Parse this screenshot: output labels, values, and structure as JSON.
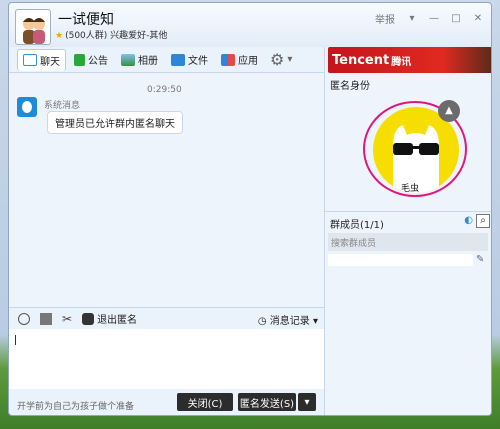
{
  "window": {
    "title": "一试便知",
    "subtitle": "(500人群) 兴趣爱好-其他",
    "controls": {
      "report": "举报",
      "dropdown": "▾",
      "minimize": "—",
      "maximize": "□",
      "close": "✕"
    }
  },
  "toolbar": {
    "items": [
      {
        "label": "聊天",
        "icon": "chat-icon",
        "active": true
      },
      {
        "label": "公告",
        "icon": "flag-icon"
      },
      {
        "label": "相册",
        "icon": "photo-icon"
      },
      {
        "label": "文件",
        "icon": "folder-icon"
      },
      {
        "label": "应用",
        "icon": "apps-icon"
      }
    ],
    "settings_icon": "gear-icon"
  },
  "banner": {
    "brand": "Tencent",
    "brand_cn": "腾讯"
  },
  "anonymous": {
    "section_label": "匿名身份",
    "name": "毛虫",
    "badge_icon": "hat-icon",
    "ring_color": "#e0177a"
  },
  "members": {
    "header": "群成员(1/1)",
    "search_placeholder": "搜索群成员"
  },
  "chat": {
    "timestamp": "0:29:50",
    "sender": "系统消息",
    "message": "管理员已允许群内匿名聊天"
  },
  "input_toolbar": {
    "exit_anonymous": "退出匿名",
    "history": "消息记录"
  },
  "footer": {
    "hint": "开学前为自己为孩子做个准备",
    "close_button": "关闭(C)",
    "send_button": "匿名发送(S)",
    "send_menu": "▾"
  },
  "colors": {
    "window_bg": "#eaf2fb",
    "accent_blue": "#1f8ad8",
    "button_dark": "#2c2c2c",
    "banner_red": "#c3151d"
  }
}
